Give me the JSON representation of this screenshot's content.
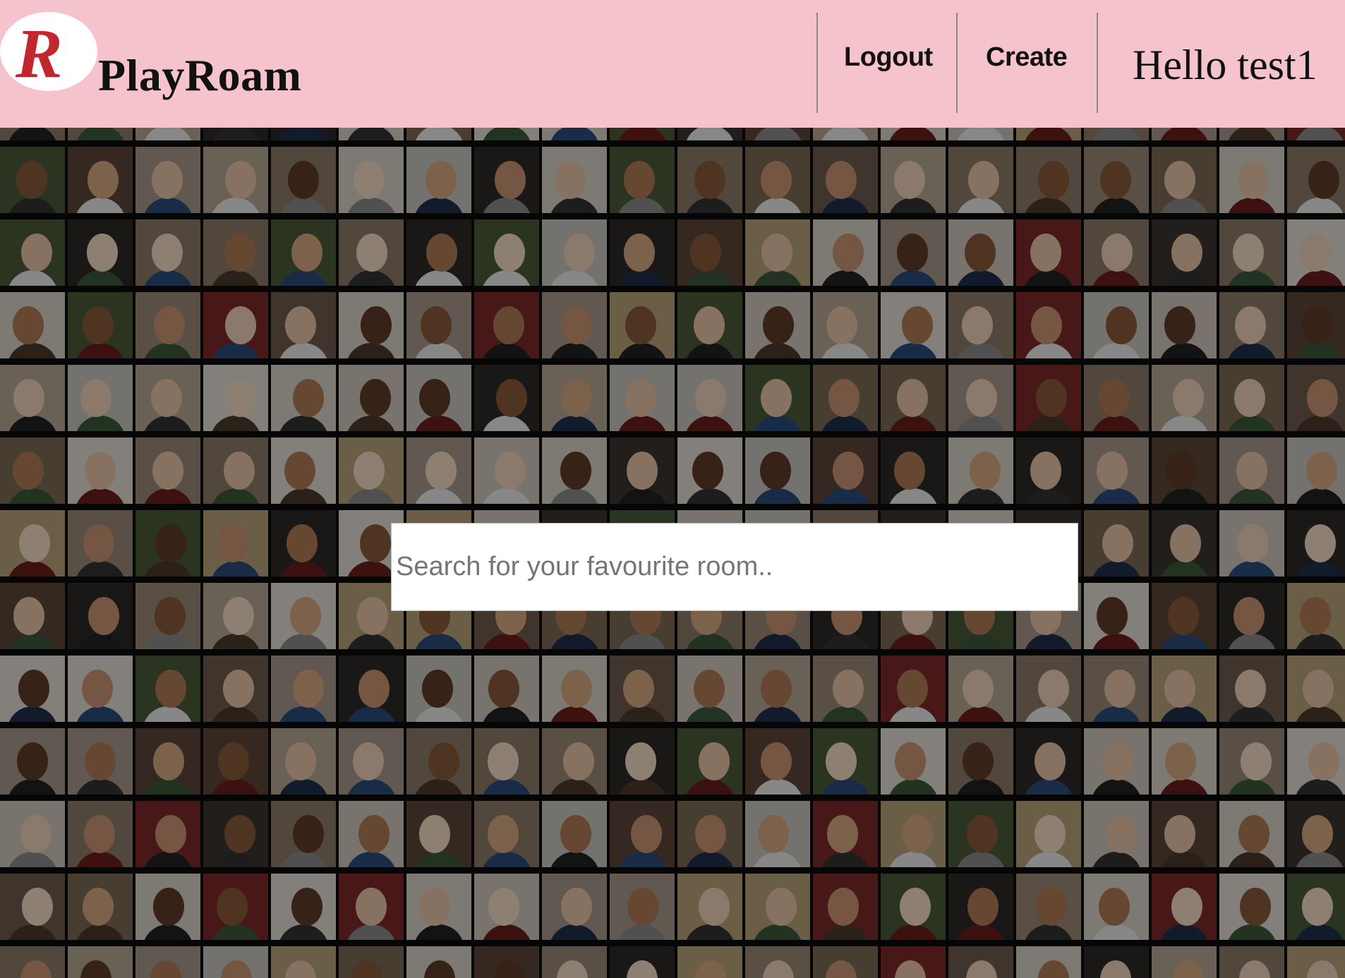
{
  "header": {
    "logo_letter": "R",
    "brand": "PlayRoam",
    "nav": {
      "logout": "Logout",
      "create": "Create"
    },
    "greeting": "Hello test1"
  },
  "search": {
    "placeholder": "Search for your favourite room..",
    "value": ""
  },
  "colors": {
    "header_bg": "#f5c3cb",
    "logo_red": "#c2262e",
    "text": "#111111"
  },
  "background": {
    "description_icon": "portrait-grid",
    "columns": 20,
    "rows": 13
  }
}
